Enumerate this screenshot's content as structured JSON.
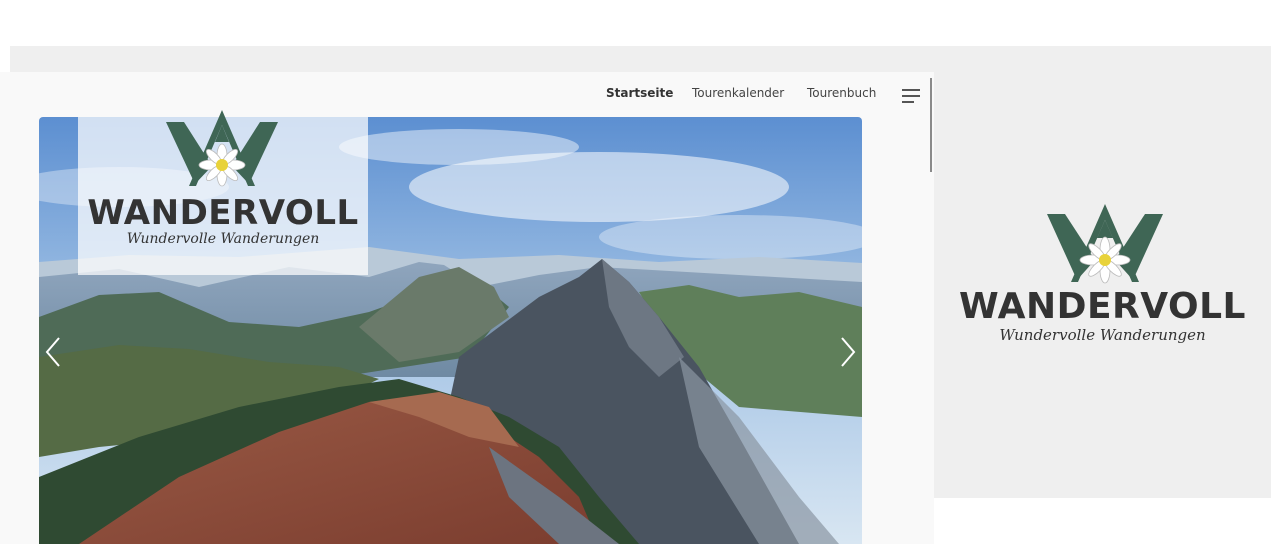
{
  "nav": {
    "items": [
      {
        "label": "Startseite",
        "active": true
      },
      {
        "label": "Tourenkalender",
        "active": false
      },
      {
        "label": "Tourenbuch",
        "active": false
      }
    ],
    "menu_icon": "hamburger-menu-icon"
  },
  "brand": {
    "name": "WANDERVOLL",
    "tagline": "Wundervolle Wanderungen",
    "colors": {
      "mountain": "#3f6655",
      "text": "#333333",
      "flower_center": "#e8d23a"
    }
  },
  "slider": {
    "prev_icon": "chevron-left-icon",
    "next_icon": "chevron-right-icon"
  }
}
